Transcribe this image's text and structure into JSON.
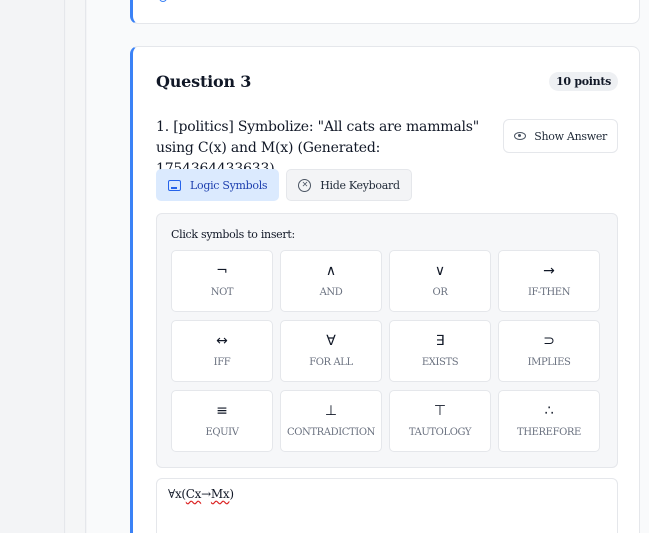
{
  "question": {
    "title": "Question 3",
    "points": "10 points",
    "text": "1. [politics] Symbolize: \"All cats are mammals\" using C(x) and M(x) (Generated: 1754364433633)",
    "show_answer_label": "Show Answer"
  },
  "toolbar": {
    "logic_symbols_label": "Logic Symbols",
    "hide_keyboard_label": "Hide Keyboard"
  },
  "keyboard": {
    "prompt": "Click symbols to insert:",
    "keys": [
      {
        "symbol": "¬",
        "label": "NOT"
      },
      {
        "symbol": "∧",
        "label": "AND"
      },
      {
        "symbol": "∨",
        "label": "OR"
      },
      {
        "symbol": "→",
        "label": "IF-THEN"
      },
      {
        "symbol": "↔",
        "label": "IFF"
      },
      {
        "symbol": "∀",
        "label": "FOR ALL"
      },
      {
        "symbol": "∃",
        "label": "EXISTS"
      },
      {
        "symbol": "⊃",
        "label": "IMPLIES"
      },
      {
        "symbol": "≡",
        "label": "EQUIV"
      },
      {
        "symbol": "⊥",
        "label": "CONTRADICTION"
      },
      {
        "symbol": "⊤",
        "label": "TAUTOLOGY"
      },
      {
        "symbol": "∴",
        "label": "THEREFORE"
      }
    ]
  },
  "answer": {
    "prefix": "∀x(",
    "part1": "Cx",
    "arrow": "→",
    "part2": "Mx",
    "suffix": ")"
  },
  "colors": {
    "accent": "#3b82f6",
    "active_bg": "#dbeafe",
    "spellcheck": "#dc2626"
  },
  "icons": {
    "show_answer": "eye-icon",
    "logic_symbols": "keyboard-icon",
    "hide_keyboard": "close-circle-icon"
  }
}
